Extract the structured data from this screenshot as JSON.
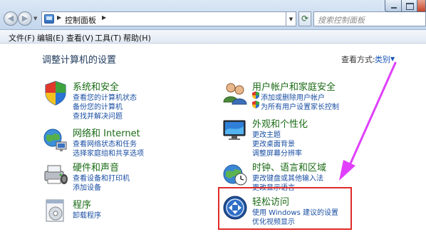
{
  "address_bar": {
    "path": [
      "控制面板"
    ],
    "search_placeholder": "搜索控制面板"
  },
  "menu": {
    "items": [
      "文件(F)",
      "编辑(E)",
      "查看(V)",
      "工具(T)",
      "帮助(H)"
    ]
  },
  "content": {
    "title": "调整计算机的设置",
    "view_by_label": "查看方式:",
    "view_by_value": "类别"
  },
  "categories": {
    "system": {
      "title": "系统和安全",
      "links": [
        "查看您的计算机状态",
        "备份您的计算机",
        "查找并解决问题"
      ],
      "icon": "system-security-icon"
    },
    "network": {
      "title": "网络和 Internet",
      "links": [
        "查看网络状态和任务",
        "选择家庭组和共享选项"
      ],
      "icon": "network-icon"
    },
    "hardware": {
      "title": "硬件和声音",
      "links": [
        "查看设备和打印机",
        "添加设备"
      ],
      "icon": "hardware-sound-icon"
    },
    "programs": {
      "title": "程序",
      "links": [
        "卸载程序"
      ],
      "icon": "programs-icon"
    },
    "users": {
      "title": "用户帐户和家庭安全",
      "links": [
        "添加或删除用户帐户",
        "为所有用户设置家长控制"
      ],
      "icon": "user-accounts-icon"
    },
    "appearance": {
      "title": "外观和个性化",
      "links": [
        "更改主题",
        "更改桌面背景",
        "调整屏幕分辨率"
      ],
      "icon": "appearance-icon"
    },
    "clock": {
      "title": "时钟、语言和区域",
      "links": [
        "更改键盘或其他输入法",
        "更改显示语言"
      ],
      "icon": "clock-language-icon"
    },
    "ease": {
      "title": "轻松访问",
      "links": [
        "使用 Windows 建议的设置",
        "优化视频显示"
      ],
      "icon": "ease-of-access-icon"
    }
  },
  "colors": {
    "category_title": "#1a6b15",
    "link": "#1a4fa3",
    "highlight_box": "#e02b2b",
    "annotation_arrow": "#e040fb"
  }
}
